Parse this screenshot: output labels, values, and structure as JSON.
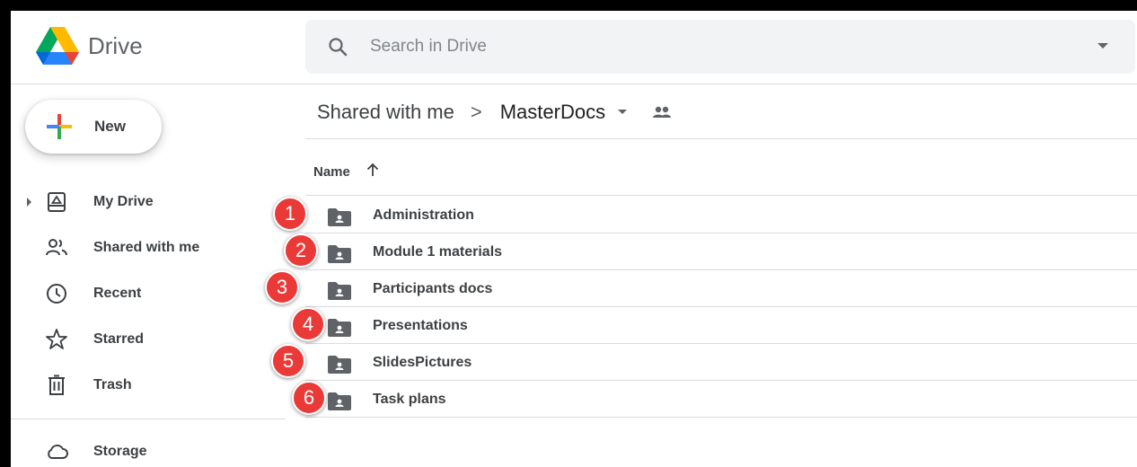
{
  "header": {
    "app_name": "Drive",
    "search_placeholder": "Search in Drive"
  },
  "sidebar": {
    "new_label": "New",
    "items": [
      {
        "label": "My Drive",
        "icon": "my-drive-icon"
      },
      {
        "label": "Shared with me",
        "icon": "people-icon"
      },
      {
        "label": "Recent",
        "icon": "clock-icon"
      },
      {
        "label": "Starred",
        "icon": "star-icon"
      },
      {
        "label": "Trash",
        "icon": "trash-icon"
      },
      {
        "label": "Storage",
        "icon": "cloud-icon"
      }
    ]
  },
  "breadcrumb": {
    "parent": "Shared with me",
    "separator": ">",
    "current": "MasterDocs"
  },
  "list": {
    "column_name": "Name",
    "sort": "ascending",
    "folders": [
      {
        "badge": "1",
        "name": "Administration"
      },
      {
        "badge": "2",
        "name": "Module 1 materials"
      },
      {
        "badge": "3",
        "name": "Participants docs"
      },
      {
        "badge": "4",
        "name": "Presentations"
      },
      {
        "badge": "5",
        "name": "SlidesPictures"
      },
      {
        "badge": "6",
        "name": "Task plans"
      }
    ]
  },
  "colors": {
    "badge": "#ea3a38",
    "text": "#3c4043",
    "icon": "#5f6368",
    "search_bg": "#f1f3f4",
    "divider": "#dadce0"
  }
}
